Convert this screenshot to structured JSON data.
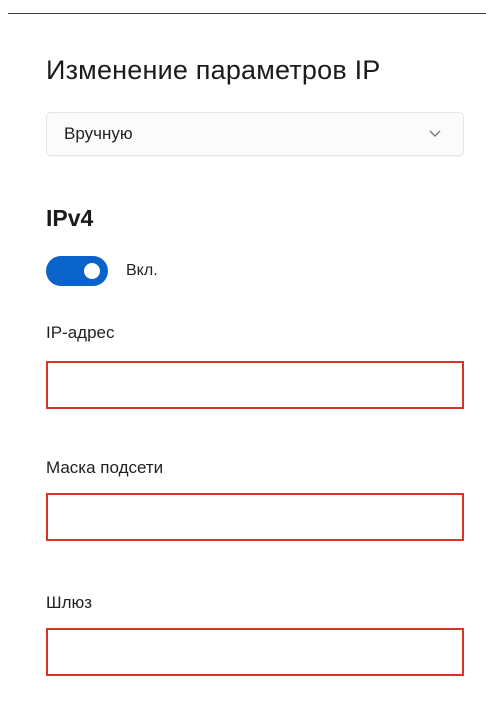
{
  "panel": {
    "title": "Изменение параметров IP"
  },
  "mode_select": {
    "value": "Вручную",
    "icon": "chevron-down-icon"
  },
  "ipv4": {
    "section_title": "IPv4",
    "toggle": {
      "state": "on",
      "label": "Вкл.",
      "color": "#0a63c8"
    },
    "fields": {
      "ip_address": {
        "label": "IP-адрес",
        "value": ""
      },
      "subnet_mask": {
        "label": "Маска подсети",
        "value": ""
      },
      "gateway": {
        "label": "Шлюз",
        "value": ""
      }
    },
    "error_border_color": "#d9342b"
  }
}
